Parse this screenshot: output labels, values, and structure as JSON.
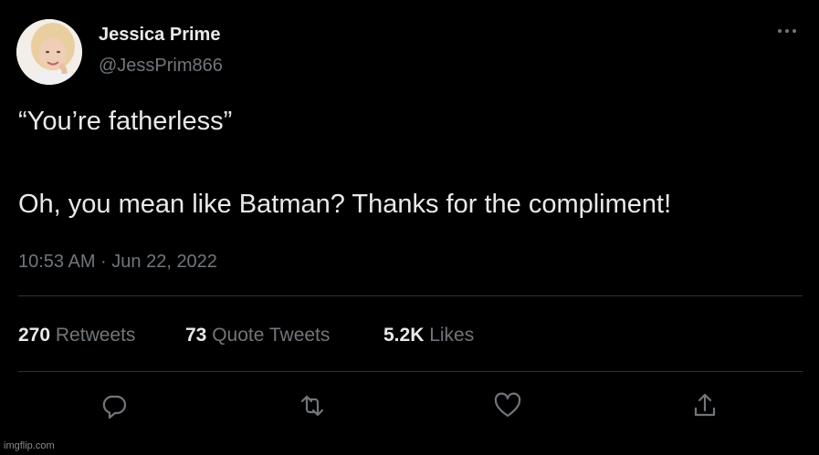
{
  "author": {
    "name": "Jessica Prime",
    "handle": "@JessPrim866"
  },
  "tweet": {
    "line1": "“You’re fatherless”",
    "line2": "Oh, you mean like Batman?  Thanks for the compliment!",
    "timestamp": "10:53 AM · Jun 22, 2022"
  },
  "stats": {
    "retweets": {
      "count": "270",
      "label": "Retweets"
    },
    "quotes": {
      "count": "73",
      "label": "Quote Tweets"
    },
    "likes": {
      "count": "5.2K",
      "label": "Likes"
    }
  },
  "icons": {
    "more": "more-horizontal-icon",
    "reply": "reply-icon",
    "retweet": "retweet-icon",
    "like": "heart-icon",
    "share": "share-icon"
  },
  "colors": {
    "background": "#000000",
    "text_primary": "#e7e9ea",
    "text_secondary": "#71767b",
    "divider": "#2f3336"
  },
  "watermark": "imgflip.com"
}
